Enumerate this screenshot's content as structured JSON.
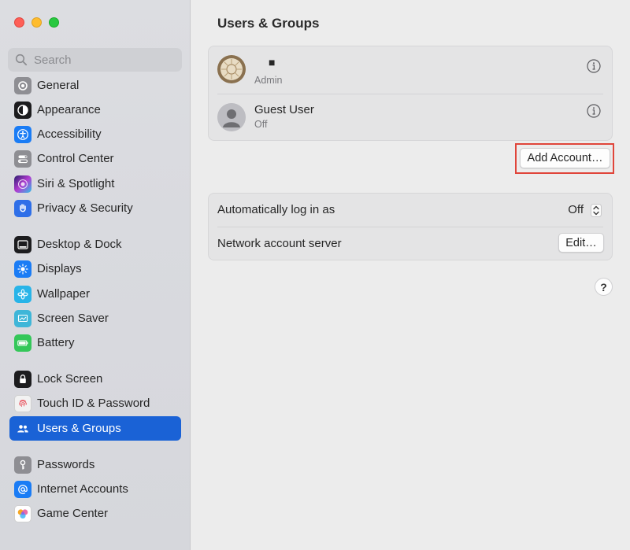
{
  "sidebar": {
    "search_placeholder": "Search",
    "items": [
      {
        "label": "General",
        "icon": "gear-icon",
        "color": "#8e8e93"
      },
      {
        "label": "Appearance",
        "icon": "appearance-icon",
        "color": "#1c1c1e"
      },
      {
        "label": "Accessibility",
        "icon": "accessibility-icon",
        "color": "#1a7cf5"
      },
      {
        "label": "Control Center",
        "icon": "control-center-icon",
        "color": "#8e8e93"
      },
      {
        "label": "Siri & Spotlight",
        "icon": "siri-icon",
        "color": "#6a3bd8"
      },
      {
        "label": "Privacy & Security",
        "icon": "hand-icon",
        "color": "#2f6fe8"
      },
      {
        "label": "Desktop & Dock",
        "icon": "desktop-dock-icon",
        "color": "#1c1c1e"
      },
      {
        "label": "Displays",
        "icon": "displays-icon",
        "color": "#1a7cf5"
      },
      {
        "label": "Wallpaper",
        "icon": "wallpaper-icon",
        "color": "#28b4e8"
      },
      {
        "label": "Screen Saver",
        "icon": "screen-saver-icon",
        "color": "#3fb6d8"
      },
      {
        "label": "Battery",
        "icon": "battery-icon",
        "color": "#34c759"
      },
      {
        "label": "Lock Screen",
        "icon": "lock-icon",
        "color": "#1c1c1e"
      },
      {
        "label": "Touch ID & Password",
        "icon": "fingerprint-icon",
        "color": "#f2f2f2"
      },
      {
        "label": "Users & Groups",
        "icon": "users-icon",
        "color": "#1a62d6",
        "selected": true
      },
      {
        "label": "Passwords",
        "icon": "key-icon",
        "color": "#8e8e93"
      },
      {
        "label": "Internet Accounts",
        "icon": "at-icon",
        "color": "#1a7cf5"
      },
      {
        "label": "Game Center",
        "icon": "game-center-icon",
        "color": "#ffffff"
      }
    ]
  },
  "main": {
    "title": "Users & Groups",
    "users": [
      {
        "name": "■",
        "role": "Admin"
      },
      {
        "name": "Guest User",
        "role": "Off"
      }
    ],
    "add_account_label": "Add Account…",
    "auto_login_label": "Automatically log in as",
    "auto_login_value": "Off",
    "network_server_label": "Network account server",
    "edit_label": "Edit…",
    "help_label": "?"
  },
  "colors": {
    "selection": "#1a62d6",
    "highlight": "#e0453a"
  }
}
